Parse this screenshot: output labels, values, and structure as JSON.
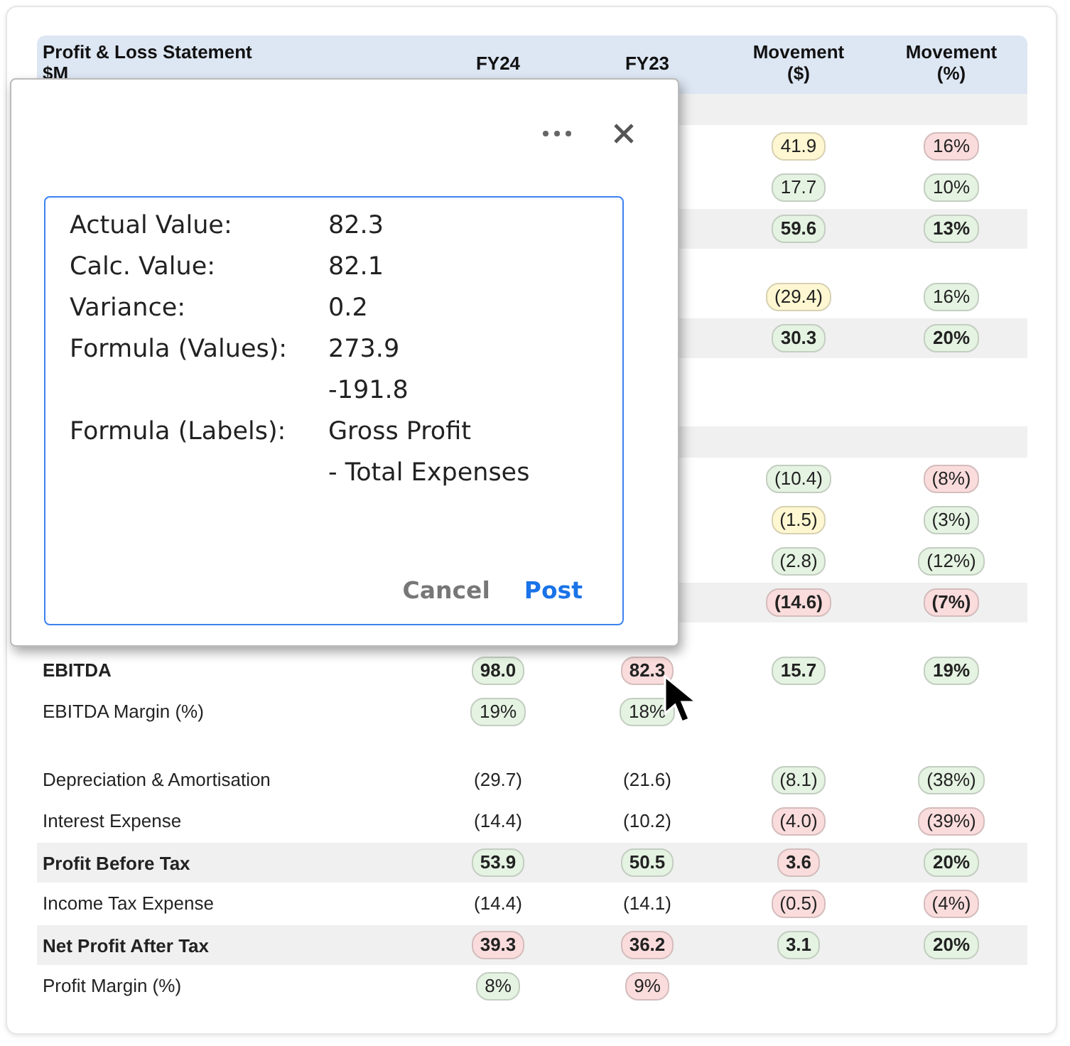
{
  "table": {
    "columns": [
      "Profit & Loss Statement\n$M",
      "FY24",
      "FY23",
      "Movement\n($)",
      "Movement\n(%)"
    ],
    "rows": [
      {
        "kind": "section",
        "cells": [
          null,
          null,
          null,
          null,
          null
        ]
      },
      {
        "kind": "line",
        "cells": [
          null,
          null,
          null,
          {
            "text": "41.9",
            "color": "#fff7d1"
          },
          {
            "text": "16%",
            "color": "#fbdcdc"
          }
        ]
      },
      {
        "kind": "line",
        "cells": [
          null,
          null,
          null,
          {
            "text": "17.7",
            "color": "#e5f3e2"
          },
          {
            "text": "10%",
            "color": "#e5f3e2"
          }
        ]
      },
      {
        "kind": "total",
        "cells": [
          null,
          null,
          null,
          {
            "text": "59.6",
            "color": "#e5f3e2"
          },
          {
            "text": "13%",
            "color": "#e5f3e2"
          }
        ]
      },
      {
        "kind": "spacer",
        "cells": [
          null,
          null,
          null,
          null,
          null
        ]
      },
      {
        "kind": "line",
        "cells": [
          null,
          null,
          null,
          {
            "text": "(29.4)",
            "color": "#fff7d1"
          },
          {
            "text": "16%",
            "color": "#e5f3e2"
          }
        ]
      },
      {
        "kind": "total",
        "cells": [
          null,
          null,
          null,
          {
            "text": "30.3",
            "color": "#e5f3e2"
          },
          {
            "text": "20%",
            "color": "#e5f3e2"
          }
        ]
      },
      {
        "kind": "line",
        "cells": [
          null,
          null,
          null,
          null,
          null
        ]
      },
      {
        "kind": "spacer",
        "cells": [
          null,
          null,
          null,
          null,
          null
        ]
      },
      {
        "kind": "section",
        "cells": [
          null,
          null,
          null,
          null,
          null
        ]
      },
      {
        "kind": "line",
        "cells": [
          null,
          null,
          null,
          {
            "text": "(10.4)",
            "color": "#e5f3e2"
          },
          {
            "text": "(8%)",
            "color": "#fbdcdc"
          }
        ]
      },
      {
        "kind": "line",
        "cells": [
          null,
          null,
          null,
          {
            "text": "(1.5)",
            "color": "#fff7d1"
          },
          {
            "text": "(3%)",
            "color": "#e5f3e2"
          }
        ]
      },
      {
        "kind": "line",
        "cells": [
          null,
          null,
          null,
          {
            "text": "(2.8)",
            "color": "#e5f3e2"
          },
          {
            "text": "(12%)",
            "color": "#e5f3e2"
          }
        ]
      },
      {
        "kind": "total",
        "cells": [
          null,
          null,
          null,
          {
            "text": "(14.6)",
            "color": "#fbdcdc"
          },
          {
            "text": "(7%)",
            "color": "#fbdcdc"
          }
        ]
      },
      {
        "kind": "spacer",
        "cells": [
          null,
          null,
          null,
          null,
          null
        ]
      },
      {
        "kind": "subtotal",
        "cells": [
          {
            "text": "EBITDA"
          },
          {
            "text": "98.0",
            "color": "#e5f3e2"
          },
          {
            "text": "82.3",
            "color": "#fbdcdc"
          },
          {
            "text": "15.7",
            "color": "#e5f3e2"
          },
          {
            "text": "19%",
            "color": "#e5f3e2"
          }
        ]
      },
      {
        "kind": "line",
        "cells": [
          {
            "text": "EBITDA Margin (%)"
          },
          {
            "text": "19%",
            "color": "#e5f3e2"
          },
          {
            "text": "18%",
            "color": "#e5f3e2"
          },
          null,
          null
        ]
      },
      {
        "kind": "spacer",
        "cells": [
          null,
          null,
          null,
          null,
          null
        ]
      },
      {
        "kind": "line",
        "cells": [
          {
            "text": "Depreciation & Amortisation"
          },
          {
            "text": "(29.7)"
          },
          {
            "text": "(21.6)"
          },
          {
            "text": "(8.1)",
            "color": "#e5f3e2"
          },
          {
            "text": "(38%)",
            "color": "#e5f3e2"
          }
        ]
      },
      {
        "kind": "line",
        "cells": [
          {
            "text": "Interest Expense"
          },
          {
            "text": "(14.4)"
          },
          {
            "text": "(10.2)"
          },
          {
            "text": "(4.0)",
            "color": "#fbdcdc"
          },
          {
            "text": "(39%)",
            "color": "#fbdcdc"
          }
        ]
      },
      {
        "kind": "total",
        "cells": [
          {
            "text": "Profit Before Tax"
          },
          {
            "text": "53.9",
            "color": "#e5f3e2"
          },
          {
            "text": "50.5",
            "color": "#e5f3e2"
          },
          {
            "text": "3.6",
            "color": "#fbdcdc"
          },
          {
            "text": "20%",
            "color": "#e5f3e2"
          }
        ]
      },
      {
        "kind": "line",
        "cells": [
          {
            "text": "Income Tax Expense"
          },
          {
            "text": "(14.4)"
          },
          {
            "text": "(14.1)"
          },
          {
            "text": "(0.5)",
            "color": "#fbdcdc"
          },
          {
            "text": "(4%)",
            "color": "#fbdcdc"
          }
        ]
      },
      {
        "kind": "total",
        "cells": [
          {
            "text": "Net Profit After Tax"
          },
          {
            "text": "39.3",
            "color": "#fbdcdc"
          },
          {
            "text": "36.2",
            "color": "#fbdcdc"
          },
          {
            "text": "3.1",
            "color": "#e5f3e2"
          },
          {
            "text": "20%",
            "color": "#e5f3e2"
          }
        ]
      },
      {
        "kind": "line",
        "cells": [
          {
            "text": "Profit Margin (%)"
          },
          {
            "text": "8%",
            "color": "#e5f3e2"
          },
          {
            "text": "9%",
            "color": "#fbdcdc"
          },
          null,
          null
        ]
      }
    ]
  },
  "dialog": {
    "details": [
      {
        "label": "Actual Value:",
        "value": "82.3"
      },
      {
        "label": "Calc. Value:",
        "value": "82.1"
      },
      {
        "label": "Variance:",
        "value": "0.2"
      },
      {
        "label": "Formula (Values):",
        "value": "273.9"
      },
      {
        "value": "-191.8"
      },
      {
        "label": "Formula (Labels):",
        "value": "Gross Profit"
      },
      {
        "value": "- Total Expenses"
      }
    ],
    "cancel": "Cancel",
    "post": "Post"
  }
}
